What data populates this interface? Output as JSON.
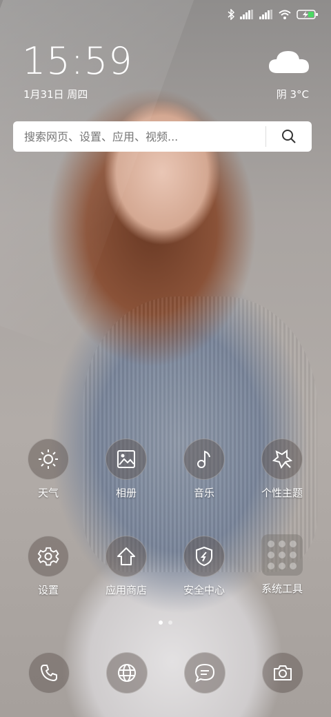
{
  "status_bar": {
    "icons": [
      "bluetooth-icon",
      "signal-icon",
      "signal-icon",
      "wifi-icon",
      "battery-charging-icon"
    ]
  },
  "clock": {
    "time": "15:59",
    "date": "1月31日 周四"
  },
  "weather": {
    "icon": "cloud-icon",
    "text": "阴 3°C"
  },
  "search": {
    "placeholder": "搜索网页、设置、应用、视频..."
  },
  "apps_row1": [
    {
      "label": "天气",
      "icon": "sun-icon"
    },
    {
      "label": "相册",
      "icon": "gallery-icon"
    },
    {
      "label": "音乐",
      "icon": "music-note-icon"
    },
    {
      "label": "个性主题",
      "icon": "theme-icon"
    }
  ],
  "apps_row2": [
    {
      "label": "设置",
      "icon": "gear-icon"
    },
    {
      "label": "应用商店",
      "icon": "store-icon"
    },
    {
      "label": "安全中心",
      "icon": "shield-icon"
    },
    {
      "label": "系统工具",
      "icon": "folder-icon"
    }
  ],
  "page_indicator": {
    "count": 2,
    "active": 1
  },
  "dock": [
    {
      "icon": "phone-icon"
    },
    {
      "icon": "browser-icon"
    },
    {
      "icon": "messages-icon"
    },
    {
      "icon": "camera-icon"
    }
  ]
}
